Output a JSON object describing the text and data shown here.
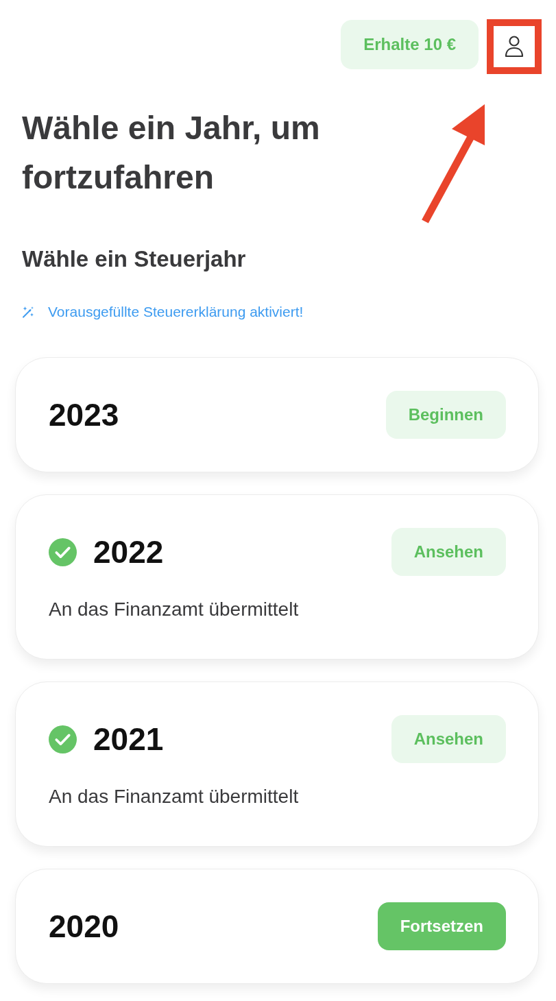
{
  "header": {
    "referral_button": "Erhalte 10 €",
    "profile_button": {
      "highlighted": true,
      "pointed_at": true
    }
  },
  "title": "Wähle ein Jahr, um fortzufahren",
  "section_title": "Wähle ein Steuerjahr",
  "notice": "Vorausgefüllte Steuererklärung aktiviert!",
  "years": [
    {
      "year": "2023",
      "submitted": false,
      "action": {
        "label": "Beginnen",
        "kind": "soft"
      }
    },
    {
      "year": "2022",
      "submitted": true,
      "status": "An das Finanzamt übermittelt",
      "action": {
        "label": "Ansehen",
        "kind": "soft"
      }
    },
    {
      "year": "2021",
      "submitted": true,
      "status": "An das Finanzamt übermittelt",
      "action": {
        "label": "Ansehen",
        "kind": "soft"
      }
    },
    {
      "year": "2020",
      "submitted": false,
      "action": {
        "label": "Fortsetzen",
        "kind": "solid"
      }
    }
  ]
}
